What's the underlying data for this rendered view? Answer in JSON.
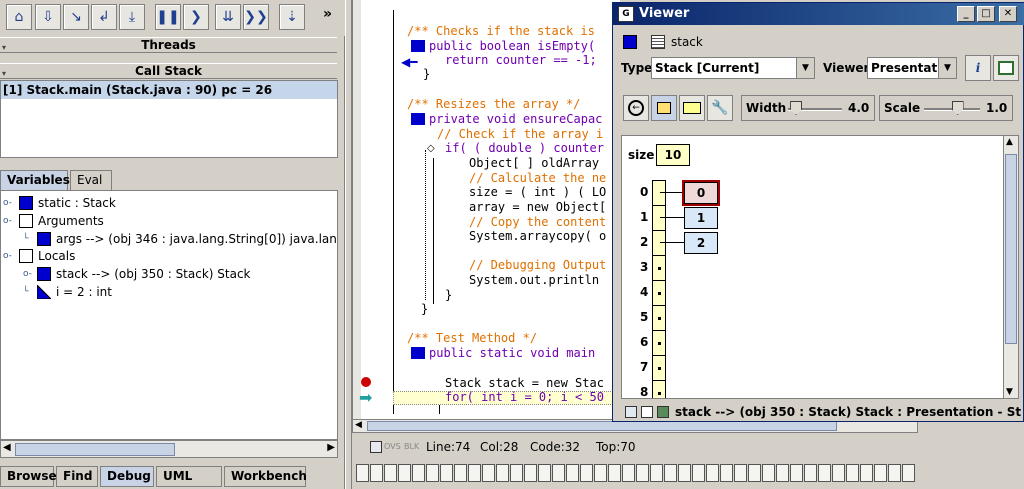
{
  "toolbar": {
    "more_label": "»",
    "buttons": [
      "run-to-cursor-icon",
      "step-over-icon",
      "step-into-icon",
      "step-out-icon",
      "step-return-icon",
      "pause-icon",
      "resume-icon",
      "step-many-icon",
      "fast-forward-icon",
      "down-arrow-icon"
    ]
  },
  "threads": {
    "title": "Threads"
  },
  "callstack": {
    "title": "Call Stack",
    "rows": [
      "[1] Stack.main (Stack.java : 90) pc = 26"
    ]
  },
  "var_tabs": {
    "variables": "Variables",
    "eval": "Eval"
  },
  "variables": {
    "static": "static  :  Stack",
    "arguments": "Arguments",
    "args": "args --> (obj 346 : java.lang.String[0])  java.lang.String",
    "locals": "Locals",
    "stack": "stack --> (obj 350 : Stack)  Stack",
    "i": "i = 2  :  int"
  },
  "bottom_tabs": [
    "Browse",
    "Find",
    "Debug",
    "UML Info",
    "Workbench"
  ],
  "editor": {
    "lines": [
      "/** Checks if the stack is",
      "public boolean isEmpty(",
      "return counter == -1;",
      "}",
      "/** Resizes the array */",
      "private void ensureCapac",
      "// Check if the array i",
      "if( ( double ) counter",
      "Object[ ] oldArray",
      "// Calculate the ne",
      "size = ( int ) ( LO",
      "array = new Object[",
      "// Copy the content",
      "System.arraycopy( o",
      "// Debugging Output",
      "System.out.println",
      "}",
      "}",
      "/** Test Method */",
      "public static void main",
      "Stack stack = new Stac",
      "for( int i = 0; i < 50"
    ]
  },
  "status": {
    "ovs": "OVS",
    "blk": "BLK",
    "line": "Line:74",
    "col": "Col:28",
    "code": "Code:32",
    "top": "Top:70"
  },
  "viewer": {
    "title": "Viewer",
    "object_name": "stack",
    "type_label": "Type",
    "type_value": "Stack  [Current]",
    "viewer_label": "Viewer",
    "viewer_value": "Presentat...",
    "width_label": "Width",
    "width_value": "4.0",
    "scale_label": "Scale",
    "scale_value": "1.0",
    "width_fraction": 0.15,
    "scale_fraction": 0.6,
    "size_label": "size",
    "size_value": "10",
    "indices": [
      "0",
      "1",
      "2",
      "3",
      "4",
      "5",
      "6",
      "7",
      "8"
    ],
    "elements": [
      "0",
      "1",
      "2"
    ],
    "status": "stack --> (obj 350 : Stack)  Stack : Presentation - Structure Identifier"
  },
  "colors": {
    "accent": "#0000cc",
    "selection": "#c6d6ea",
    "titlebar": "#0a246a",
    "comment": "#e07000",
    "keyword": "#7000b0"
  }
}
